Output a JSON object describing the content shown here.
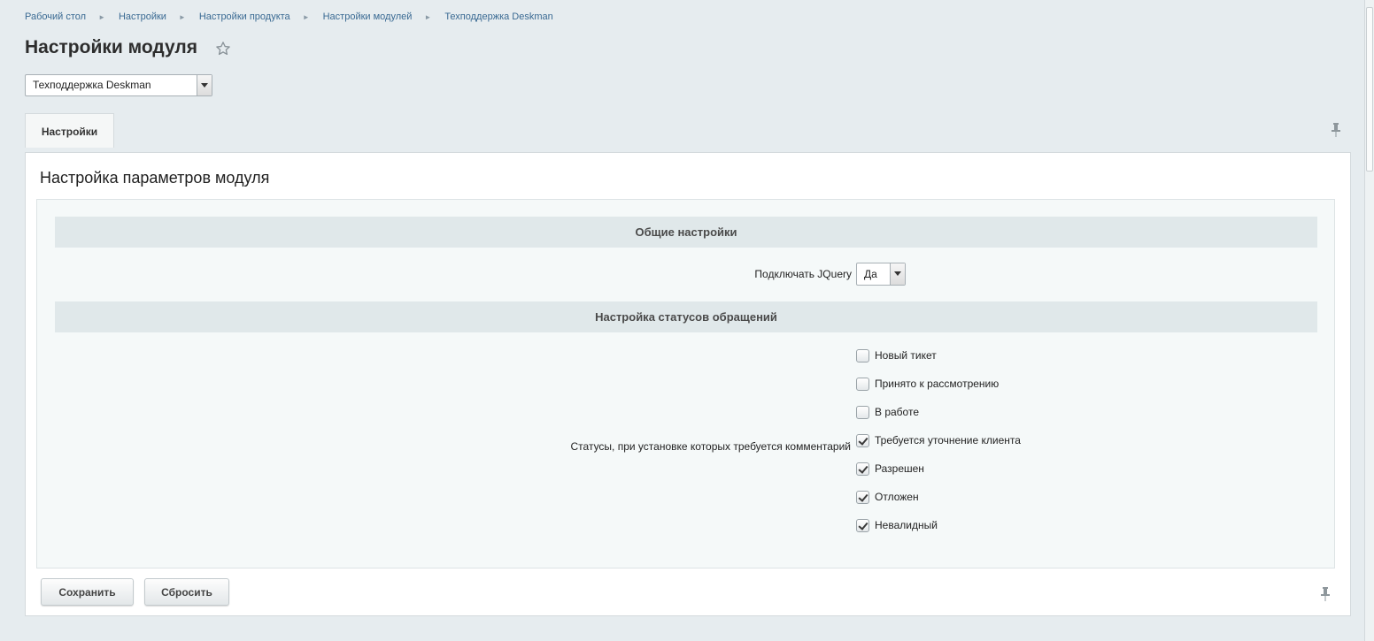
{
  "breadcrumb": {
    "items": [
      "Рабочий стол",
      "Настройки",
      "Настройки продукта",
      "Настройки модулей",
      "Техподдержка Deskman"
    ]
  },
  "page_title": "Настройки модуля",
  "module_select": {
    "value": "Техподдержка Deskman"
  },
  "tabs": [
    {
      "label": "Настройки",
      "active": true
    }
  ],
  "panel": {
    "title": "Настройка параметров модуля",
    "sections": {
      "general": {
        "heading": "Общие настройки",
        "jquery_label": "Подключать JQuery",
        "jquery_value": "Да"
      },
      "statuses": {
        "heading": "Настройка статусов обращений",
        "label": "Статусы, при установке которых требуется комментарий",
        "items": [
          {
            "label": "Новый тикет",
            "checked": false
          },
          {
            "label": "Принято к рассмотрению",
            "checked": false
          },
          {
            "label": "В работе",
            "checked": false
          },
          {
            "label": "Требуется уточнение клиента",
            "checked": true
          },
          {
            "label": "Разрешен",
            "checked": true
          },
          {
            "label": "Отложен",
            "checked": true
          },
          {
            "label": "Невалидный",
            "checked": true
          }
        ]
      }
    }
  },
  "buttons": {
    "save": "Сохранить",
    "reset": "Сбросить"
  },
  "icons": {
    "favorite": "star-outline-icon",
    "pin": "pin-icon"
  }
}
